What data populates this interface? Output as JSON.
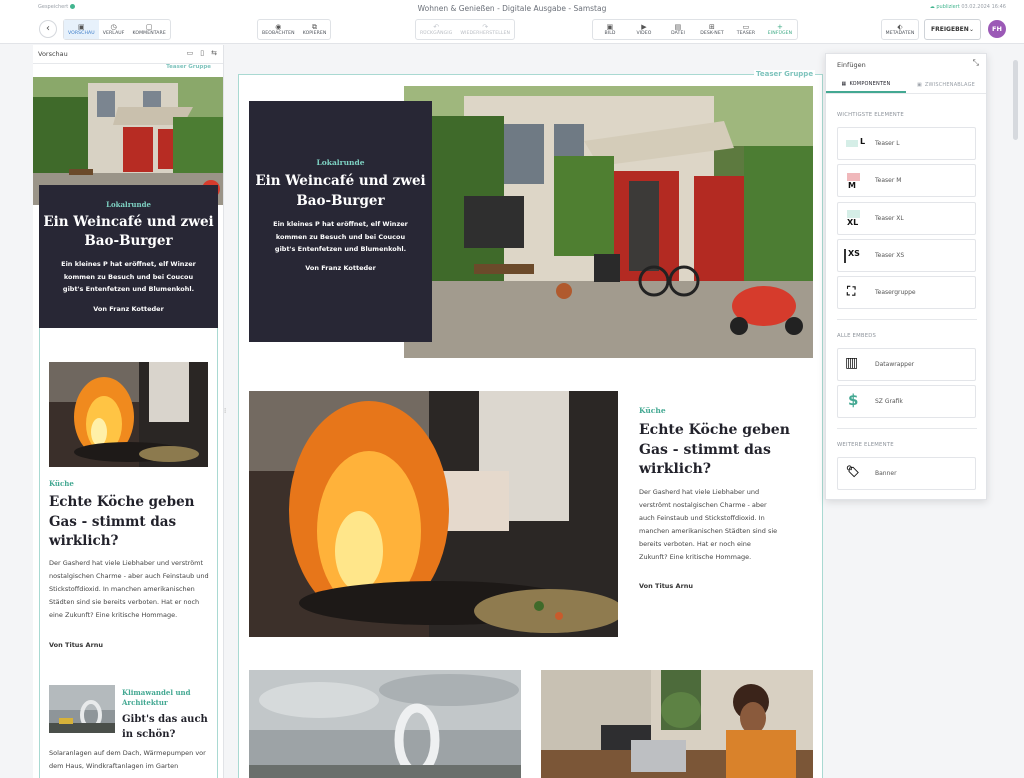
{
  "topbar": {
    "saved": "Gespeichert",
    "doc_title": "Wohnen & Genießen - Digitale Ausgabe - Samstag",
    "published_label": "publiziert",
    "published_date": "03.02.2024 16:46",
    "back_icon": "‹",
    "group1": [
      {
        "label": "VORSCHAU",
        "icon": "▣"
      },
      {
        "label": "VERLAUF",
        "icon": "◷"
      },
      {
        "label": "KOMMENTARE",
        "icon": "▢"
      }
    ],
    "group2": [
      {
        "label": "BEOBACHTEN",
        "icon": "◉"
      },
      {
        "label": "KOPIEREN",
        "icon": "⧉"
      }
    ],
    "group3": [
      {
        "label": "RÜCKGÄNGIG",
        "icon": "↶"
      },
      {
        "label": "WIEDERHERSTELLEN",
        "icon": "↷"
      }
    ],
    "group4": [
      {
        "label": "BILD",
        "icon": "▣"
      },
      {
        "label": "VIDEO",
        "icon": "▶"
      },
      {
        "label": "DATEI",
        "icon": "▤"
      },
      {
        "label": "DESK-NET",
        "icon": "⊞"
      },
      {
        "label": "TEASER",
        "icon": "▭"
      },
      {
        "label": "EINFÜGEN",
        "icon": "+"
      }
    ],
    "metadata": {
      "label": "METADATEN",
      "icon": "⬖"
    },
    "freigeben": "FREIGEBEN",
    "freigeben_chevron": "⌄",
    "avatar_initials": "FH"
  },
  "preview": {
    "title": "Vorschau",
    "icons": [
      "▭",
      "▯",
      "⇆"
    ],
    "group_label": "Teaser Gruppe",
    "lead": {
      "kicker": "Lokalrunde",
      "headline": "Ein Weincafé und zwei Bao-Burger",
      "text": "Ein kleines P hat eröffnet, elf Winzer kommen zu Besuch und bei Coucou gibt's Entenfetzen und Blumenkohl.",
      "author": "Von Franz Kotteder"
    },
    "second": {
      "kicker": "Küche",
      "headline": "Echte Köche geben Gas - stimmt das wirklich?",
      "text": "Der Gasherd hat viele Liebhaber und verströmt nostalgischen Charme - aber auch Feinstaub und Stickstoffdioxid. In manchen amerikanischen Städten sind sie bereits verboten. Hat er noch eine Zukunft? Eine kritische Hommage.",
      "author": "Von Titus Arnu"
    },
    "third": {
      "kicker": "Klimawandel und Architektur",
      "headline": "Gibt's das auch in schön?",
      "text": "Solaranlagen auf dem Dach, Wärmepumpen vor dem Haus, Windkraftanlagen im Garten"
    }
  },
  "main": {
    "group_label": "Teaser Gruppe",
    "lead": {
      "kicker": "Lokalrunde",
      "headline": "Ein Weincafé und zwei Bao-Burger",
      "text": "Ein kleines P hat eröffnet, elf Winzer kommen zu Besuch und bei Coucou gibt's Entenfetzen und Blumenkohl.",
      "author": "Von Franz Kotteder"
    },
    "second": {
      "kicker": "Küche",
      "headline": "Echte Köche geben Gas - stimmt das wirklich?",
      "text": "Der Gasherd hat viele Liebhaber und verströmt nostalgischen Charme - aber auch Feinstaub und Stickstoffdioxid. In manchen amerikanischen Städten sind sie bereits verboten. Hat er noch eine Zukunft? Eine kritische Hommage.",
      "author": "Von Titus Arnu"
    }
  },
  "insert_panel": {
    "title": "Einfügen",
    "collapse_icon": "⤡",
    "tabs": [
      {
        "label": "KOMPONENTEN",
        "icon": "▦"
      },
      {
        "label": "ZWISCHENABLAGE",
        "icon": "▣"
      }
    ],
    "sections": {
      "important": "WICHTIGSTE ELEMENTE",
      "embeds": "ALLE EMBEDS",
      "more": "WEITERE ELEMENTE"
    },
    "components": [
      {
        "name": "Teaser L",
        "badge": "L"
      },
      {
        "name": "Teaser M",
        "badge": "M"
      },
      {
        "name": "Teaser XL",
        "badge": "XL"
      },
      {
        "name": "Teaser XS",
        "badge": "XS"
      },
      {
        "name": "Teasergruppe",
        "badge": "⛶"
      },
      {
        "name": "Datawrapper",
        "badge": "▥"
      },
      {
        "name": "SZ Grafik",
        "badge": "$"
      },
      {
        "name": "Banner",
        "badge": "🏷"
      }
    ]
  },
  "colors": {
    "accent_green": "#43a892",
    "dark_teaser": "#282735",
    "avatar": "#9b59b6",
    "active_blue": "#3a7bc8"
  }
}
